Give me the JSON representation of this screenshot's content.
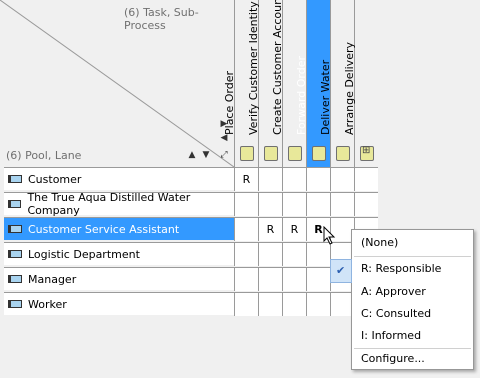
{
  "corner": {
    "columns_label": "(6) Task, Sub-Process",
    "rows_label": "(6) Pool, Lane"
  },
  "columns": [
    {
      "label": "Place Order",
      "type": "task",
      "selected": false
    },
    {
      "label": "Verify Customer Identity",
      "type": "task",
      "selected": false
    },
    {
      "label": "Create Customer Account",
      "type": "task",
      "selected": false
    },
    {
      "label": "Forward Order",
      "type": "task",
      "selected": true
    },
    {
      "label": "Deliver Water",
      "type": "task",
      "selected": false
    },
    {
      "label": "Arrange Delivery",
      "type": "sub-process",
      "selected": false
    }
  ],
  "rows": [
    {
      "label": "Customer",
      "type": "lane",
      "selected": false,
      "cells": [
        "R",
        "",
        "",
        "",
        "",
        ""
      ]
    },
    {
      "label": "The True Aqua Distilled Water Company",
      "type": "lane",
      "selected": false,
      "cells": [
        "",
        "",
        "",
        "",
        "",
        ""
      ]
    },
    {
      "label": "Customer Service Assistant",
      "type": "lane",
      "selected": true,
      "cells": [
        "",
        "R",
        "R",
        "R",
        "",
        ""
      ]
    },
    {
      "label": "Logistic Department",
      "type": "lane",
      "selected": false,
      "cells": [
        "",
        "",
        "",
        "",
        "",
        ""
      ]
    },
    {
      "label": "Manager",
      "type": "lane",
      "selected": false,
      "cells": [
        "",
        "",
        "",
        "",
        "",
        ""
      ]
    },
    {
      "label": "Worker",
      "type": "lane",
      "selected": false,
      "cells": [
        "",
        "",
        "",
        "",
        "",
        ""
      ]
    }
  ],
  "context_menu": {
    "items": [
      {
        "label": "(None)",
        "checked": false
      },
      {
        "label": "R: Responsible",
        "checked": true
      },
      {
        "label": "A: Approver",
        "checked": false
      },
      {
        "label": "C: Consulted",
        "checked": false
      },
      {
        "label": "I: Informed",
        "checked": false
      },
      {
        "label": "Configure...",
        "checked": false
      }
    ]
  },
  "colors": {
    "selection": "#3399ff",
    "task_fill": "#e8e89a",
    "lane_fill": "#a9d4f0"
  }
}
